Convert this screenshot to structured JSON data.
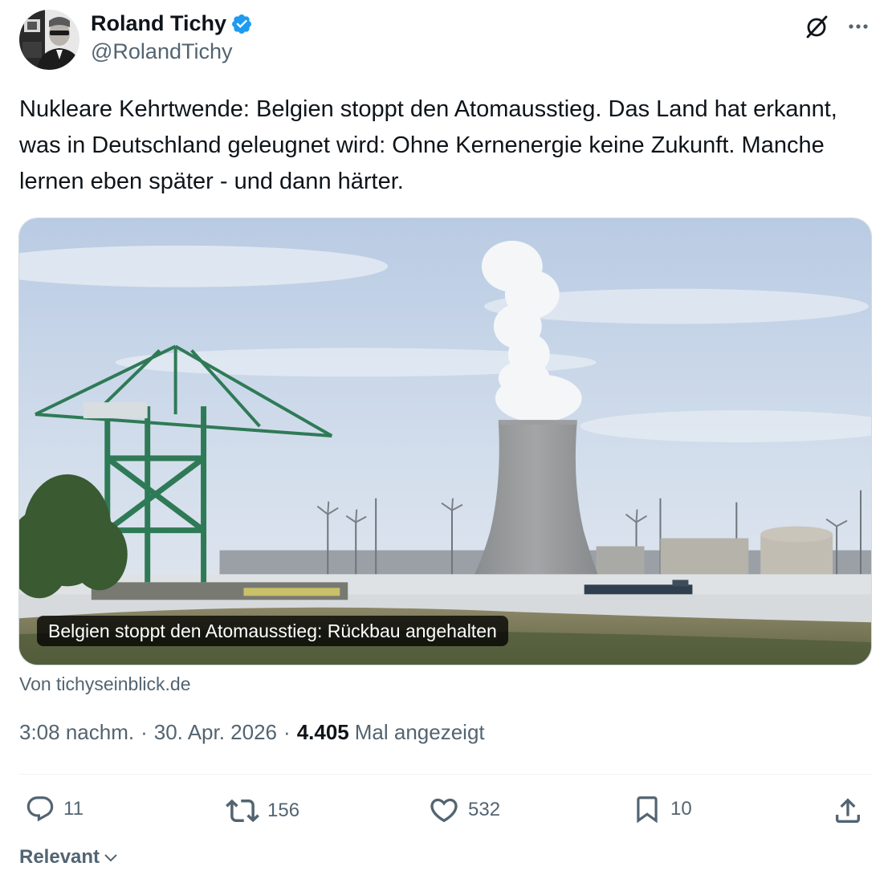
{
  "author": {
    "name": "Roland Tichy",
    "handle": "@RolandTichy",
    "verified": true
  },
  "icons": {
    "verified": "verified-badge-icon",
    "grok": "grok-icon",
    "more": "more-dots-icon",
    "reply": "reply-icon",
    "retweet": "retweet-icon",
    "like": "heart-icon",
    "bookmark": "bookmark-icon",
    "share": "share-icon",
    "sort": "chevron-down-icon"
  },
  "tweet": {
    "text": "Nukleare Kehrtwende: Belgien stoppt den Atomausstieg. Das Land hat erkannt, was in Deutschland geleugnet wird: Ohne Kernenergie keine Zukunft. Manche lernen eben später - und dann härter."
  },
  "card": {
    "title": "Belgien stoppt den Atomausstieg: Rückbau angehalten",
    "source": "Von tichyseinblick.de"
  },
  "meta": {
    "time": "3:08 nachm.",
    "separator": "·",
    "date": "30. Apr. 2026",
    "views_count": "4.405",
    "views_label": "Mal angezeigt"
  },
  "actions": {
    "replies": "11",
    "retweets": "156",
    "likes": "532",
    "bookmarks": "10"
  },
  "sort": {
    "label": "Relevant"
  },
  "colors": {
    "text_primary": "#0f1419",
    "text_secondary": "#536471",
    "verified_blue": "#1d9bf0",
    "border": "#cfd9de"
  }
}
